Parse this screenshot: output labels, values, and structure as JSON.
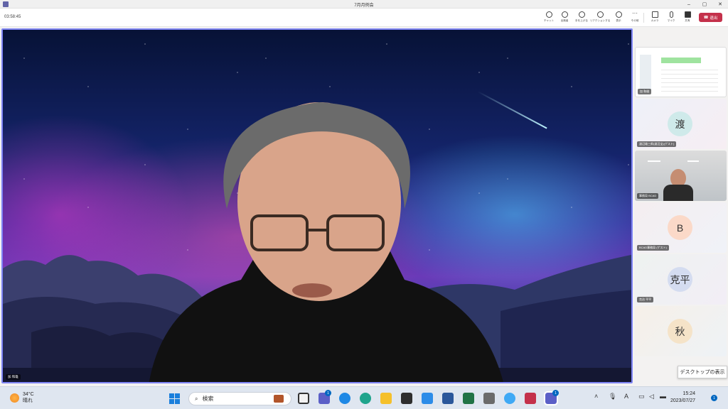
{
  "window": {
    "title": "7月月例会"
  },
  "toolbar": {
    "timer": "03:58:45",
    "buttons": [
      {
        "label": "チャット"
      },
      {
        "label": "出席者"
      },
      {
        "label": "手を上げる"
      },
      {
        "label": "リアクションする"
      },
      {
        "label": "表示"
      },
      {
        "label": "その他"
      },
      {
        "label": "カメラ"
      },
      {
        "label": "マイク"
      },
      {
        "label": "共有"
      }
    ],
    "leave_label": "退出"
  },
  "stage": {
    "speaker_name": "加 和雄"
  },
  "participants": [
    {
      "kind": "share",
      "name": "加 和雄"
    },
    {
      "kind": "avatar",
      "initials": "渡",
      "name": "渡辺雄三郎(渡辺宝)(ゲスト)",
      "color": "#cfeaea"
    },
    {
      "kind": "video",
      "name": "事務局 BCAD"
    },
    {
      "kind": "avatar",
      "initials": "B",
      "name": "BCAD事務局 (ゲスト)",
      "color": "#fbd9c8"
    },
    {
      "kind": "avatar",
      "initials": "克平",
      "name": "克治 平平",
      "color": "#d4dcf0"
    },
    {
      "kind": "avatar",
      "initials": "秋",
      "name": "",
      "color": "#f5e3c8"
    }
  ],
  "tooltip": "デスクトップの表示",
  "taskbar": {
    "weather_temp": "34°C",
    "weather_desc": "晴れ",
    "search_placeholder": "検索",
    "chat_badge": "1",
    "teams_badge": "1",
    "ime": "A",
    "time": "15:24",
    "date": "2023/07/27",
    "notif_badge": "1"
  }
}
